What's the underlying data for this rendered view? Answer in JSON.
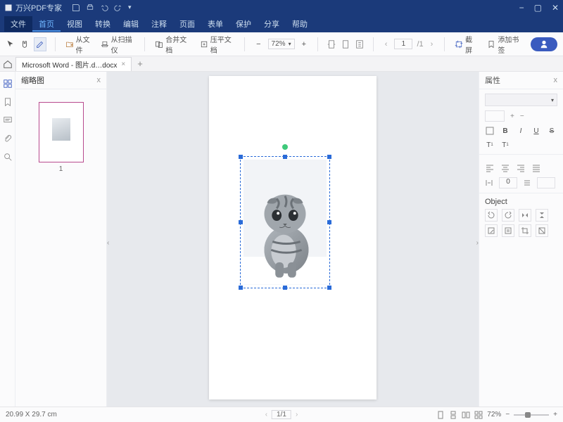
{
  "app": {
    "title": "万兴PDF专家"
  },
  "win": {
    "min": "−",
    "max": "▢",
    "close": "✕"
  },
  "menubar": {
    "file": "文件",
    "items": [
      "首页",
      "视图",
      "转换",
      "编辑",
      "注释",
      "页面",
      "表单",
      "保护",
      "分享",
      "帮助"
    ]
  },
  "toolbar": {
    "from_file": "从文件",
    "from_scanner": "从扫描仪",
    "merge": "合并文档",
    "compress": "压平文档",
    "zoom_minus": "−",
    "zoom_value": "72%",
    "zoom_plus": "+",
    "page_prev": "‹",
    "page_val": "1",
    "page_total": "/1",
    "page_next": "›",
    "crop": "截屏",
    "bookmark": "添加书签"
  },
  "tab": {
    "name": "Microsoft Word - 图片.d…docx",
    "close": "×",
    "add": "+"
  },
  "thumbnails": {
    "title": "缩略图",
    "close": "x",
    "page_num": "1"
  },
  "properties": {
    "title": "属性",
    "close": "x",
    "rotation_value": "0",
    "object_title": "Object"
  },
  "status": {
    "dims": "20.99 X 29.7 cm",
    "page": "1/1",
    "zoom": "72%",
    "minus": "−",
    "plus": "+"
  }
}
